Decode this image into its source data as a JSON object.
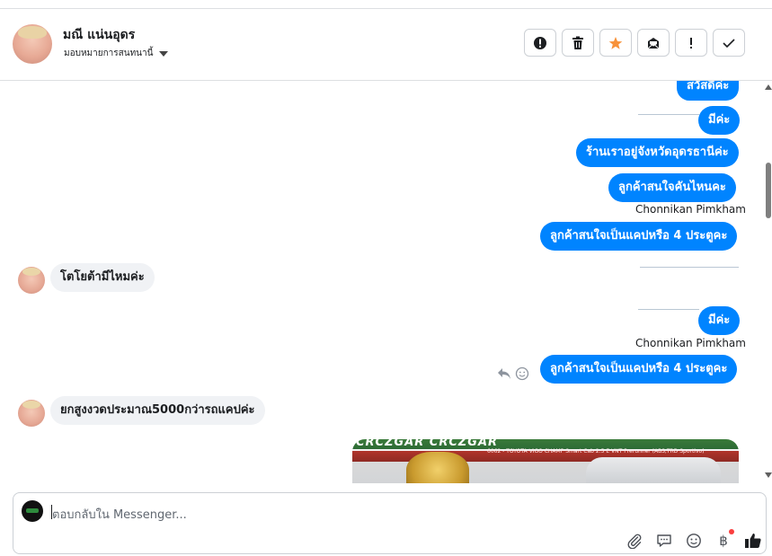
{
  "header": {
    "contact_name": "มณี แน่นอุดร",
    "assign_label": "มอบหมายการสนทนานี้",
    "actions": [
      {
        "name": "mark-spam",
        "icon": "exclamation-circle-icon"
      },
      {
        "name": "delete",
        "icon": "trash-icon"
      },
      {
        "name": "star",
        "icon": "star-icon",
        "color": "#f7923a"
      },
      {
        "name": "mark-unread",
        "icon": "envelope-icon"
      },
      {
        "name": "follow-up",
        "icon": "exclamation-icon"
      },
      {
        "name": "done",
        "icon": "checkmark-icon"
      }
    ]
  },
  "messages": [
    {
      "dir": "out",
      "text": "สวัสดีค่ะ"
    },
    {
      "dir": "out",
      "text": "มีค่ะ"
    },
    {
      "dir": "out",
      "text": "ร้านเราอยู่จังหวัดอุดรธานีค่ะ"
    },
    {
      "dir": "out",
      "text": "ลูกค้าสนใจคันไหนคะ"
    },
    {
      "dir": "out",
      "sender": "Chonnikan Pimkham",
      "text": "ลูกค้าสนใจเป็นแคปหรือ 4 ประตูคะ"
    },
    {
      "dir": "in",
      "text": "โตโยต้ามีไหมค่ะ"
    },
    {
      "dir": "out",
      "text": "มีค่ะ"
    },
    {
      "dir": "out",
      "sender": "Chonnikan Pimkham",
      "text": "ลูกค้าสนใจเป็นแคปหรือ 4 ประตูคะ"
    },
    {
      "dir": "in",
      "text": "ยกสูงงวดประมาณ5000กว่ารถแคปค่ะ"
    }
  ],
  "image_message": {
    "banner_text": "CRCZGAR CRCZGAR",
    "strip_text": "6062 - TOYOTA VIGO CHAMP Smart Cab 2.5 E VNT Prerunner (ABS,TRD Sportivo)"
  },
  "composer": {
    "placeholder": "ตอบกลับใน Messenger..."
  },
  "colors": {
    "outgoing_bubble": "#0084ff",
    "incoming_bubble": "#f0f2f5",
    "star_accent": "#f7923a",
    "notification_dot": "#fa3e3e"
  }
}
